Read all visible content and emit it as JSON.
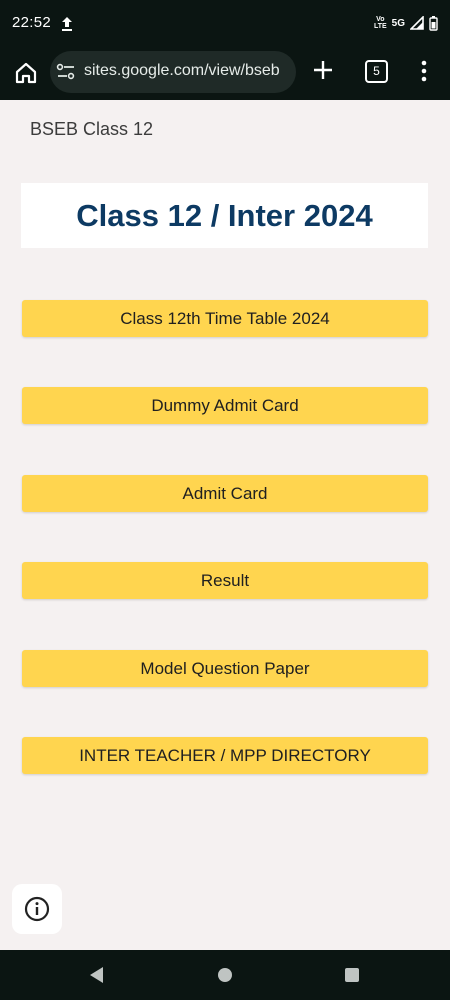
{
  "status_bar": {
    "time": "22:52",
    "volte_line1": "Vo",
    "volte_line2": "LTE",
    "network": "5G"
  },
  "browser": {
    "url": "sites.google.com/view/bseb",
    "tab_count": "5"
  },
  "page": {
    "site_name": "BSEB Class 12",
    "heading": "Class 12 / Inter 2024",
    "buttons": [
      {
        "label": "Class 12th Time Table 2024"
      },
      {
        "label": "Dummy Admit Card"
      },
      {
        "label": "Admit Card"
      },
      {
        "label": "Result"
      },
      {
        "label": "Model Question Paper"
      },
      {
        "label": "INTER TEACHER / MPP DIRECTORY"
      }
    ]
  },
  "colors": {
    "heading": "#0d3a63",
    "button_bg": "#ffd54f",
    "page_bg": "#f5f1f1",
    "chrome_bg": "#0b1512"
  }
}
